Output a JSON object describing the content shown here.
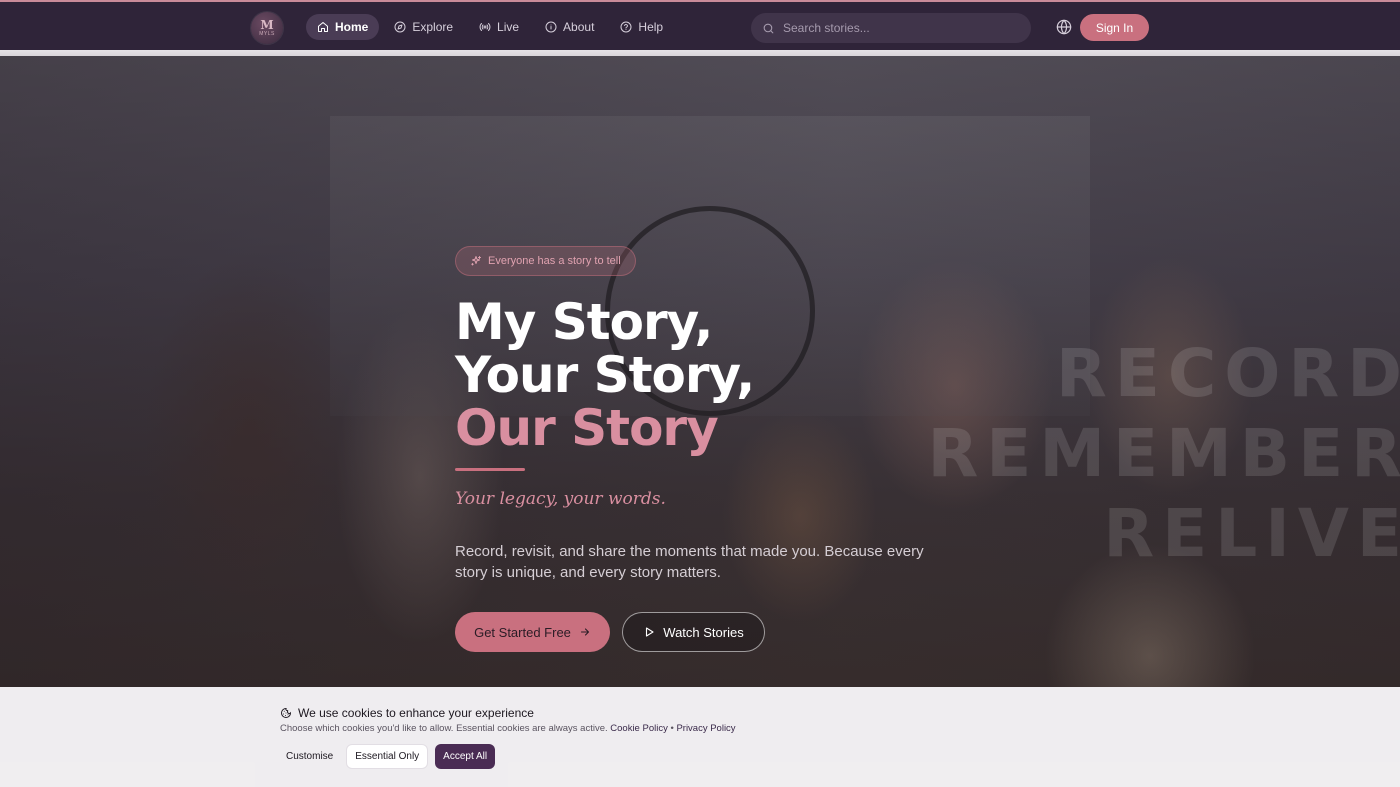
{
  "app": {
    "logo_text": "M",
    "logo_subtext": "MYLS"
  },
  "nav": {
    "items": [
      {
        "label": "Home",
        "icon": "home-icon",
        "active": true
      },
      {
        "label": "Explore",
        "icon": "compass-icon",
        "active": false
      },
      {
        "label": "Live",
        "icon": "broadcast-icon",
        "active": false
      },
      {
        "label": "About",
        "icon": "info-icon",
        "active": false
      },
      {
        "label": "Help",
        "icon": "help-icon",
        "active": false
      }
    ]
  },
  "search": {
    "placeholder": "Search stories...",
    "value": ""
  },
  "header": {
    "language_icon": "globe-icon",
    "sign_in_label": "Sign In"
  },
  "hero": {
    "tagline": "Everyone has a story to tell",
    "headline_line1": "My Story,",
    "headline_line2": "Your Story,",
    "headline_line3": "Our Story",
    "subheadline": "Your legacy, your words.",
    "description": "Record, revisit, and share the moments that made you. Because every story is unique, and every story matters.",
    "primary_cta": "Get Started Free",
    "secondary_cta": "Watch Stories",
    "background_words": [
      "RECORD",
      "REMEMBER",
      "RELIVE"
    ]
  },
  "cookie_banner": {
    "title": "We use cookies to enhance your experience",
    "text": "Choose which cookies you'd like to allow. Essential cookies are always active.",
    "cookie_policy_link": "Cookie Policy",
    "separator": "•",
    "privacy_policy_link": "Privacy Policy",
    "customise_label": "Customise",
    "essential_only_label": "Essential Only",
    "accept_all_label": "Accept All"
  },
  "colors": {
    "accent": "#c9707f",
    "accent_light": "#d98fa0",
    "nav_bg": "#2f2439",
    "accept_button": "#4a2c54"
  }
}
